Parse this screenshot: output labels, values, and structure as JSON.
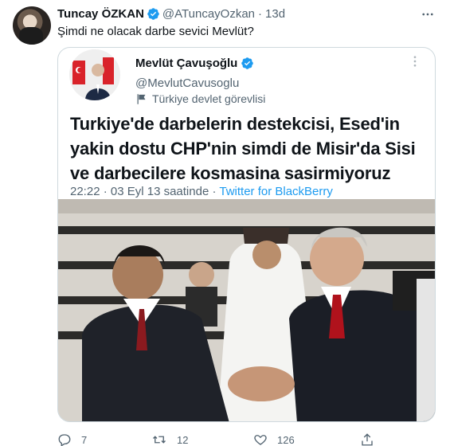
{
  "tweet": {
    "author_name": "Tuncay ÖZKAN",
    "author_handle": "@ATuncayOzkan",
    "separator": "·",
    "time": "13d",
    "text": "Şimdi ne olacak darbe sevici Mevlüt?"
  },
  "quote": {
    "name": "Mevlüt Çavuşoğlu",
    "handle": "@MevlutCavusoglu",
    "label": "Türkiye devlet görevlisi",
    "text": "Turkiye'de darbelerin destekcisi, Esed'in yakin dostu CHP'nin simdi de Misir'da Sisi ve darbecilere kosmasina sasirmiyoruz",
    "meta": "22:22 · 03 Eyl 13 saatinde · ",
    "source": "Twitter for BlackBerry"
  },
  "actions": {
    "replies": "7",
    "retweets": "12",
    "likes": "126"
  },
  "colors": {
    "accent": "#1d9bf0",
    "muted": "#536471"
  }
}
